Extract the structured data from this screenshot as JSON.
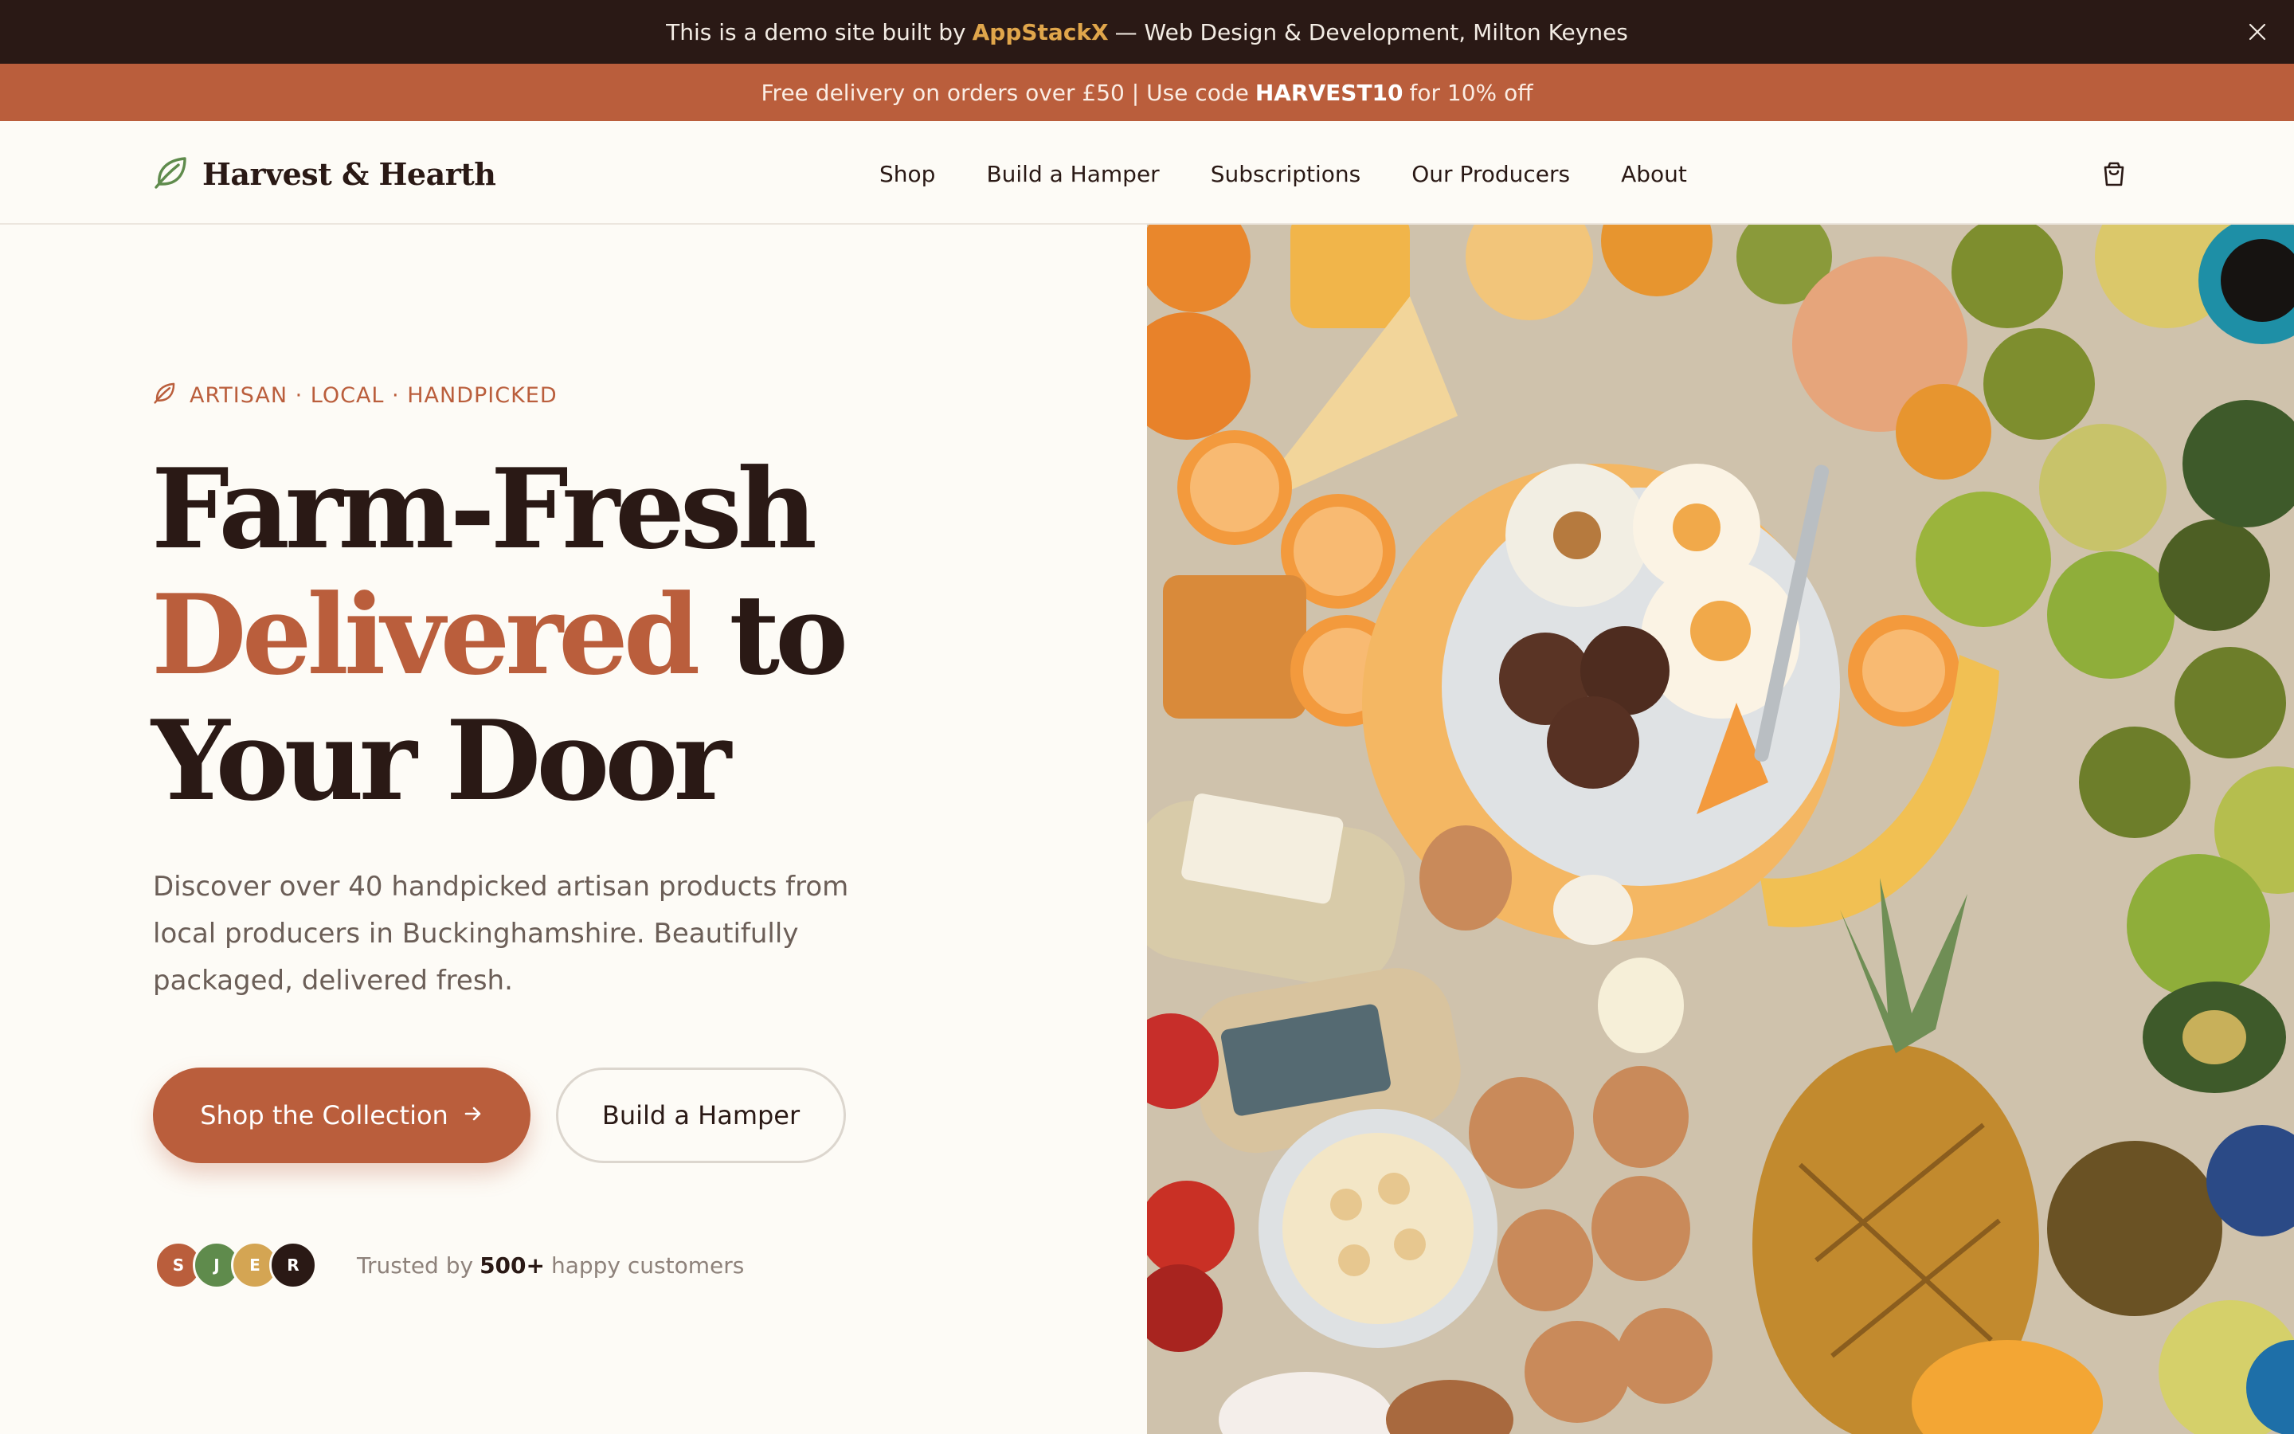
{
  "demo_bar": {
    "prefix": "This is a demo site built by",
    "brand": "AppStackX",
    "suffix": "— Web Design & Development, Milton Keynes"
  },
  "promo_bar": {
    "prefix": "Free delivery on orders over £50 | Use code",
    "code": "HARVEST10",
    "suffix": "for 10% off"
  },
  "header": {
    "logo_text": "Harvest & Hearth",
    "nav": [
      "Shop",
      "Build a Hamper",
      "Subscriptions",
      "Our Producers",
      "About"
    ]
  },
  "hero": {
    "eyebrow": "ARTISAN · LOCAL · HANDPICKED",
    "headline_line1": "Farm-Fresh",
    "headline_accent": "Delivered",
    "headline_line2_rest": "to",
    "headline_line3": "Your Door",
    "subtext": "Discover over 40 handpicked artisan products from local producers in Buckinghamshire. Beautifully packaged, delivered fresh.",
    "primary_button": "Shop the Collection",
    "secondary_button": "Build a Hamper",
    "avatars": [
      "S",
      "J",
      "E",
      "R"
    ],
    "trust_prefix": "Trusted by",
    "trust_count": "500+",
    "trust_suffix": "happy customers"
  },
  "colors": {
    "terracotta": "#BA5E3C",
    "dark_brown": "#2A1915",
    "cream": "#FDFBF6",
    "gold": "#E0A64B",
    "avatar_colors": [
      "#BA5E3C",
      "#5F8B4C",
      "#D4A553",
      "#2A1915"
    ]
  },
  "icons": {
    "logo": "leaf-icon",
    "cart": "shopping-bag-icon",
    "close": "close-icon",
    "arrow": "arrow-right-icon"
  }
}
